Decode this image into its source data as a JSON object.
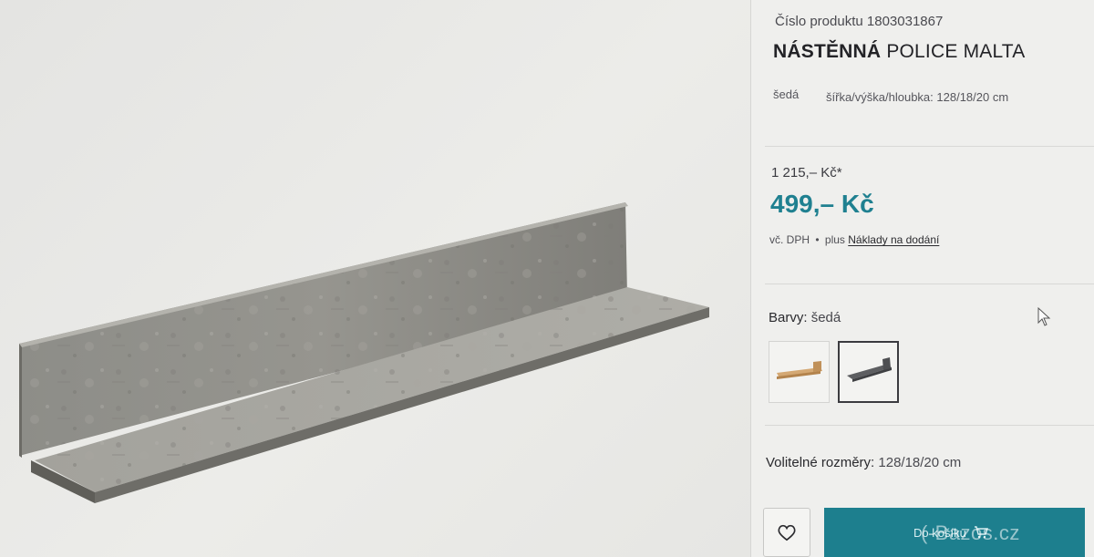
{
  "product": {
    "number_label": "Číslo produktu 1803031867",
    "title_bold": "NÁSTĚNNÁ",
    "title_rest": " POLICE MALTA",
    "color": "šedá",
    "dimensions": "šířka/výška/hloubka: 128/18/20 cm"
  },
  "price": {
    "old": "1 215,– Kč*",
    "new": "499,– Kč",
    "vat": "vč. DPH",
    "separator": "•",
    "plus": "plus",
    "shipping_link": "Náklady na dodání"
  },
  "colors": {
    "label": "Barvy:",
    "value": "šedá",
    "options": [
      {
        "name": "oak",
        "swatch": "#c79a63",
        "selected": false
      },
      {
        "name": "grey",
        "swatch": "#4e4f52",
        "selected": true
      }
    ]
  },
  "dimensions_option": {
    "label": "Volitelné rozměry:",
    "value": "128/18/20 cm"
  },
  "actions": {
    "add_to_cart": "Do košíku"
  },
  "watermark": "(-Bazos.cz",
  "icons": {
    "wishlist": "heart-icon",
    "cart": "cart-icon",
    "cursor": "mouse-pointer-icon"
  },
  "theme": {
    "accent": "#1f8090",
    "cart_button": "#1d7f8e"
  }
}
